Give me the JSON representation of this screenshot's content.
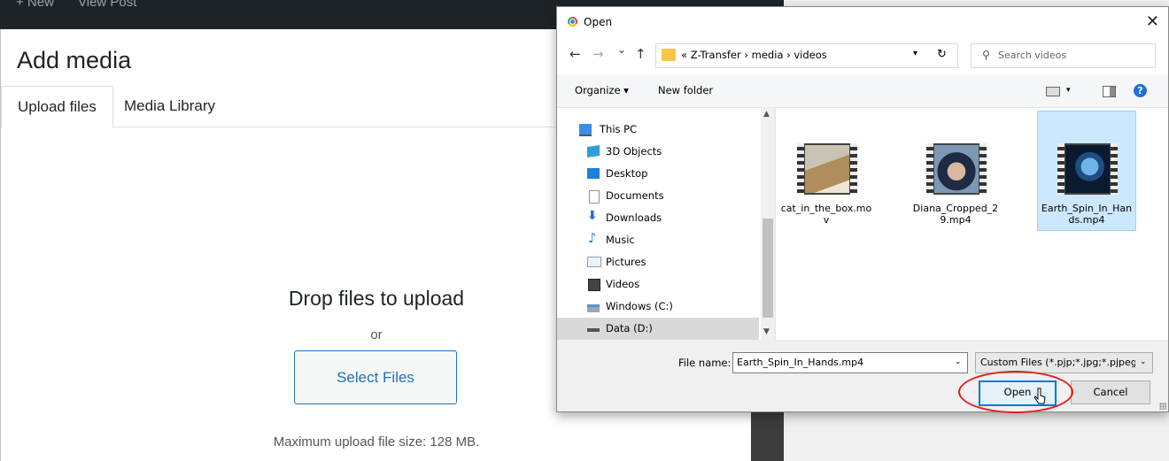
{
  "admin_bar": {
    "new_label": "+ New",
    "view_post_label": "View Post"
  },
  "media_modal": {
    "title": "Add media",
    "tabs": [
      {
        "label": "Upload files"
      },
      {
        "label": "Media Library"
      }
    ],
    "drop_title": "Drop files to upload",
    "or_text": "or",
    "select_button": "Select Files",
    "max_upload": "Maximum upload file size: 128 MB."
  },
  "dialog": {
    "title": "Open",
    "close_glyph": "✕",
    "nav": {
      "back": "←",
      "forward": "→",
      "recent": "⌄",
      "up": "↑"
    },
    "breadcrumb": "« Z-Transfer  ›  media  ›  videos",
    "refresh_glyph": "↻",
    "search_placeholder": "Search videos",
    "toolbar": {
      "organize": "Organize ▾",
      "new_folder": "New folder",
      "help": "?"
    },
    "nav_items": [
      {
        "label": "This PC",
        "icon": "computer-icon",
        "color": "#3b8ee8"
      },
      {
        "label": "3D Objects",
        "icon": "cube-icon",
        "color": "#2f9fd8"
      },
      {
        "label": "Desktop",
        "icon": "desktop-icon",
        "color": "#1e7fd6"
      },
      {
        "label": "Documents",
        "icon": "document-icon",
        "color": "#9aa7b4"
      },
      {
        "label": "Downloads",
        "icon": "download-icon",
        "color": "#2b6fd1"
      },
      {
        "label": "Music",
        "icon": "music-icon",
        "color": "#1e7fd6"
      },
      {
        "label": "Pictures",
        "icon": "pictures-icon",
        "color": "#8aa0b8"
      },
      {
        "label": "Videos",
        "icon": "videos-icon",
        "color": "#444"
      },
      {
        "label": "Windows (C:)",
        "icon": "drive-icon",
        "color": "#5a8fd6"
      },
      {
        "label": "Data (D:)",
        "icon": "drive-icon",
        "color": "#666"
      }
    ],
    "files": [
      {
        "name": "cat_in_the_box.mov",
        "selected": false
      },
      {
        "name": "Diana_Cropped_29.mp4",
        "selected": false
      },
      {
        "name": "Earth_Spin_In_Hands.mp4",
        "selected": true
      }
    ],
    "file_name_label": "File name:",
    "file_name_value": "Earth_Spin_In_Hands.mp4",
    "file_type": "Custom Files (*.pjp;*.jpg;*.pjpeg",
    "open_button": "Open",
    "cancel_button": "Cancel"
  },
  "colors": {
    "wp_blue": "#2271b1",
    "win_accent": "#0078d7",
    "highlight_ring": "#e0201b",
    "selection": "#cce8ff"
  }
}
